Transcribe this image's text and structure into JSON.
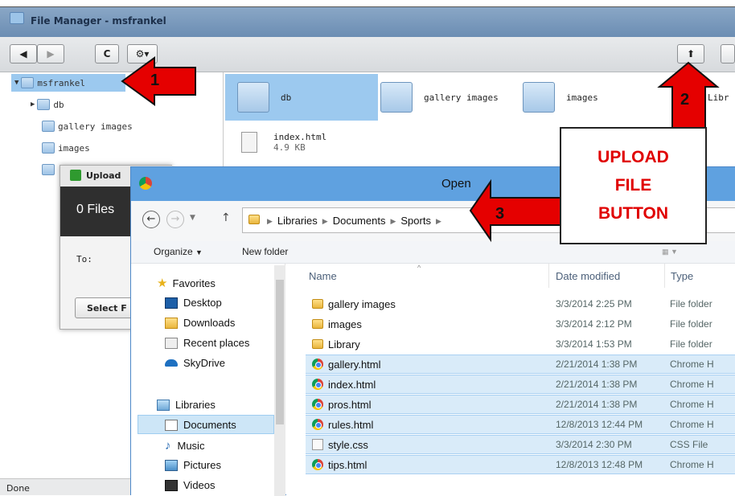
{
  "file_manager": {
    "title": "File Manager - msfrankel",
    "status": "Done",
    "tree": [
      {
        "label": "msfrankel"
      },
      {
        "label": "db"
      },
      {
        "label": "gallery images"
      },
      {
        "label": "images"
      }
    ],
    "grid": [
      {
        "label": "db"
      },
      {
        "label": "gallery images"
      },
      {
        "label": "images"
      },
      {
        "label": "Libr"
      },
      {
        "label": "index.html",
        "size": "4.9 KB"
      }
    ]
  },
  "upload_dialog": {
    "title": "Upload",
    "files_text": "0 Files",
    "to_label": "To:",
    "select_button": "Select F"
  },
  "open_dialog": {
    "title": "Open",
    "breadcrumb": [
      "Libraries",
      "Documents",
      "Sports"
    ],
    "organize": "Organize",
    "new_folder": "New folder",
    "nav": {
      "favorites": "Favorites",
      "desktop": "Desktop",
      "downloads": "Downloads",
      "recent": "Recent places",
      "skydrive": "SkyDrive",
      "libraries": "Libraries",
      "documents": "Documents",
      "music": "Music",
      "pictures": "Pictures",
      "videos": "Videos"
    },
    "columns": {
      "name": "Name",
      "date": "Date modified",
      "type": "Type"
    },
    "files": [
      {
        "name": "gallery images",
        "date": "3/3/2014 2:25 PM",
        "type": "File folder",
        "icon": "folder-icon",
        "selected": false
      },
      {
        "name": "images",
        "date": "3/3/2014 2:12 PM",
        "type": "File folder",
        "icon": "folder-icon",
        "selected": false
      },
      {
        "name": "Library",
        "date": "3/3/2014 1:53 PM",
        "type": "File folder",
        "icon": "folder-icon",
        "selected": false
      },
      {
        "name": "gallery.html",
        "date": "2/21/2014 1:38 PM",
        "type": "Chrome H",
        "icon": "chrome-icon",
        "selected": true
      },
      {
        "name": "index.html",
        "date": "2/21/2014 1:38 PM",
        "type": "Chrome H",
        "icon": "chrome-icon",
        "selected": true
      },
      {
        "name": "pros.html",
        "date": "2/21/2014 1:38 PM",
        "type": "Chrome H",
        "icon": "chrome-icon",
        "selected": true
      },
      {
        "name": "rules.html",
        "date": "12/8/2013 12:44 PM",
        "type": "Chrome H",
        "icon": "chrome-icon",
        "selected": true
      },
      {
        "name": "style.css",
        "date": "3/3/2014 2:30 PM",
        "type": "CSS File",
        "icon": "css-file-icon",
        "selected": true
      },
      {
        "name": "tips.html",
        "date": "12/8/2013 12:48 PM",
        "type": "Chrome H",
        "icon": "chrome-icon",
        "selected": true
      }
    ]
  },
  "callouts": {
    "one": "1",
    "two": "2",
    "three": "3",
    "upload_line1": "UPLOAD",
    "upload_line2": "FILE",
    "upload_line3": "BUTTON",
    "arrow_color": "#e50000"
  }
}
